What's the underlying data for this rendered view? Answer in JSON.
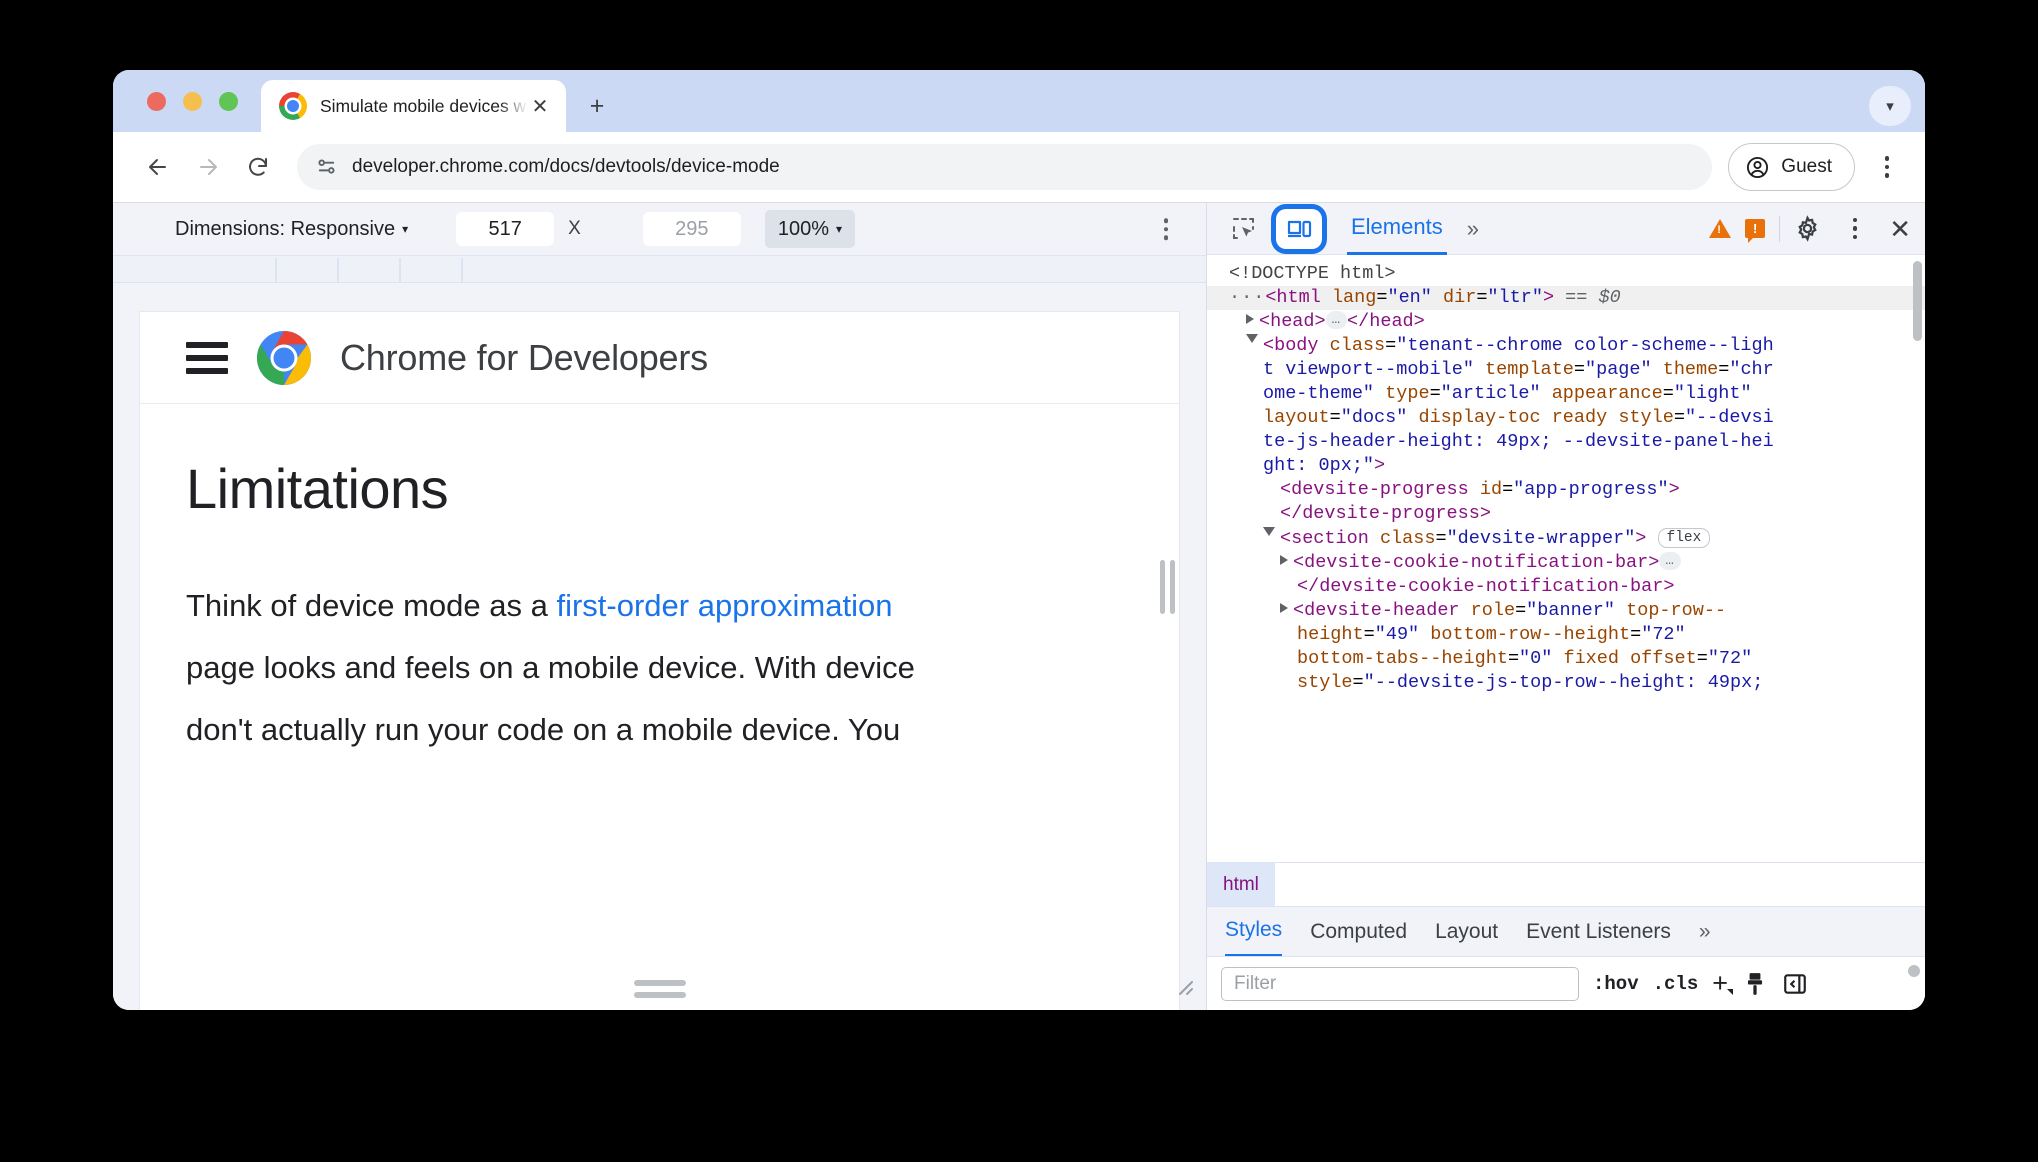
{
  "browser": {
    "tab": {
      "title": "Simulate mobile devices with",
      "close_label": "✕"
    },
    "new_tab_label": "+",
    "tab_search_icon": "chevron-down-icon",
    "url": "developer.chrome.com/docs/devtools/device-mode",
    "guest_label": "Guest",
    "nav": {
      "back": "back-icon",
      "forward": "forward-icon",
      "reload": "reload-icon"
    }
  },
  "device_toolbar": {
    "dimensions_label": "Dimensions: Responsive",
    "caret": "▾",
    "width_value": "517",
    "times": "X",
    "height_placeholder": "295",
    "zoom_value": "100%"
  },
  "page": {
    "site_title": "Chrome for Developers",
    "heading": "Limitations",
    "paragraph_lines": [
      {
        "pre": "Think of device mode as a ",
        "link": "first-order approximation",
        "post": ""
      },
      {
        "pre": "page looks and feels on a mobile device. With device",
        "link": "",
        "post": ""
      },
      {
        "pre": "don't actually run your code on a mobile device. You",
        "link": "",
        "post": ""
      }
    ]
  },
  "devtools": {
    "inspect_icon": "inspect-element-icon",
    "device_toggle_icon": "device-toolbar-icon",
    "tab_elements": "Elements",
    "more_tabs": "»",
    "warning_count": "",
    "error_count": "",
    "gear_icon": "settings-gear-icon",
    "kebab_icon": "more-options-icon",
    "close_icon": "close-devtools-icon",
    "dom_lines": [
      {
        "indent": 0,
        "tri": "",
        "html": "<span class=\"plain\">&lt;!DOCTYPE html&gt;</span>"
      },
      {
        "indent": 0,
        "tri": "",
        "selected": true,
        "html": "<span class=\"dots3\">···</span><span class=\"tag\">&lt;html</span> <span class=\"attr\">lang</span>=<span class=\"val\">\"en\"</span> <span class=\"attr\">dir</span>=<span class=\"val\">\"ltr\"</span><span class=\"tag\">&gt;</span> <span class=\"italic\">== $0</span>"
      },
      {
        "indent": 1,
        "tri": "closed",
        "html": "<span class=\"tag\">&lt;head&gt;</span><span class=\"ellip\">…</span><span class=\"tag\">&lt;/head&gt;</span>"
      },
      {
        "indent": 1,
        "tri": "open",
        "html": "<span class=\"tag\">&lt;body</span> <span class=\"attr\">class</span>=<span class=\"val\">\"tenant--chrome color-scheme--ligh</span>"
      },
      {
        "indent": 2,
        "tri": "",
        "html": "<span class=\"val\">t viewport--mobile\"</span> <span class=\"attr\">template</span>=<span class=\"val\">\"page\"</span> <span class=\"attr\">theme</span>=<span class=\"val\">\"chr</span>"
      },
      {
        "indent": 2,
        "tri": "",
        "html": "<span class=\"val\">ome-theme\"</span> <span class=\"attr\">type</span>=<span class=\"val\">\"article\"</span> <span class=\"attr\">appearance</span>=<span class=\"val\">\"light\"</span>"
      },
      {
        "indent": 2,
        "tri": "",
        "html": "<span class=\"attr\">layout</span>=<span class=\"val\">\"docs\"</span> <span class=\"attr\">display-toc ready</span> <span class=\"attr\">style</span>=<span class=\"val\">\"--devsi</span>"
      },
      {
        "indent": 2,
        "tri": "",
        "html": "<span class=\"val\">te-js-header-height: 49px; --devsite-panel-hei</span>"
      },
      {
        "indent": 2,
        "tri": "",
        "html": "<span class=\"val\">ght: 0px;\"</span><span class=\"tag\">&gt;</span>"
      },
      {
        "indent": 3,
        "tri": "",
        "html": "<span class=\"tag\">&lt;devsite-progress</span> <span class=\"attr\">id</span>=<span class=\"val\">\"app-progress\"</span><span class=\"tag\">&gt;</span>"
      },
      {
        "indent": 3,
        "tri": "",
        "html": "<span class=\"tag\">&lt;/devsite-progress&gt;</span>"
      },
      {
        "indent": 2,
        "tri": "open",
        "html": "<span class=\"tag\">&lt;section</span> <span class=\"attr\">class</span>=<span class=\"val\">\"devsite-wrapper\"</span><span class=\"tag\">&gt;</span> <span class=\"badge\">flex</span>"
      },
      {
        "indent": 3,
        "tri": "closed",
        "html": "<span class=\"tag\">&lt;devsite-cookie-notification-bar&gt;</span><span class=\"ellip\">…</span>"
      },
      {
        "indent": 4,
        "tri": "",
        "html": "<span class=\"tag\">&lt;/devsite-cookie-notification-bar&gt;</span>"
      },
      {
        "indent": 3,
        "tri": "closed",
        "html": "<span class=\"tag\">&lt;devsite-header</span> <span class=\"attr\">role</span>=<span class=\"val\">\"banner\"</span> <span class=\"attr\">top-row--</span>"
      },
      {
        "indent": 4,
        "tri": "",
        "html": "<span class=\"attr\">height</span>=<span class=\"val\">\"49\"</span> <span class=\"attr\">bottom-row--height</span>=<span class=\"val\">\"72\"</span>"
      },
      {
        "indent": 4,
        "tri": "",
        "html": "<span class=\"attr\">bottom-tabs--height</span>=<span class=\"val\">\"0\"</span> <span class=\"attr\">fixed offset</span>=<span class=\"val\">\"72\"</span>"
      },
      {
        "indent": 4,
        "tri": "",
        "html": "<span class=\"attr\">style</span>=<span class=\"val\">\"--devsite-js-top-row--height: 49px;</span>"
      }
    ],
    "breadcrumb": [
      "html"
    ],
    "style_tabs": [
      "Styles",
      "Computed",
      "Layout",
      "Event Listeners"
    ],
    "style_tabs_more": "»",
    "filter_placeholder": "Filter",
    "hov_label": ":hov",
    "cls_label": ".cls",
    "new_rule_label": "+",
    "brush_icon": "color-brush-icon",
    "panel_icon": "toggle-sidebar-icon"
  }
}
